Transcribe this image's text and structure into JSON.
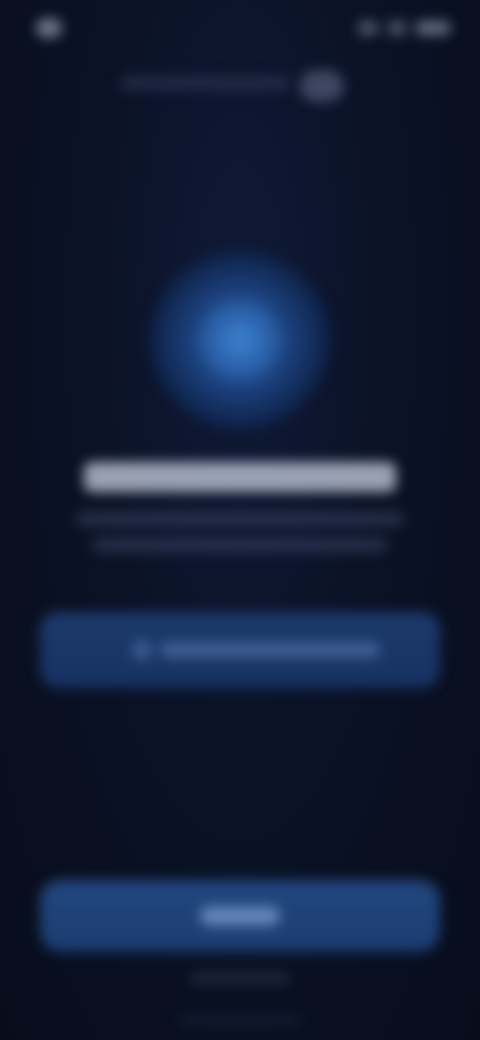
{
  "status_bar": {
    "time": "",
    "icons": [
      "signal-icon",
      "wifi-icon",
      "battery-icon"
    ]
  },
  "url_bar": {
    "url": "",
    "reload_icon": "reload-icon"
  },
  "hero": {
    "icon": "app-icon",
    "accent_color": "#2f6fbd"
  },
  "content": {
    "title": "",
    "subtitle": ""
  },
  "primary_card": {
    "label": "",
    "icon": "link-icon"
  },
  "cta": {
    "label": ""
  },
  "footer": {
    "text": ""
  },
  "colors": {
    "background": "#0a1022",
    "card": "#1c3a6c",
    "button": "#21477f"
  }
}
